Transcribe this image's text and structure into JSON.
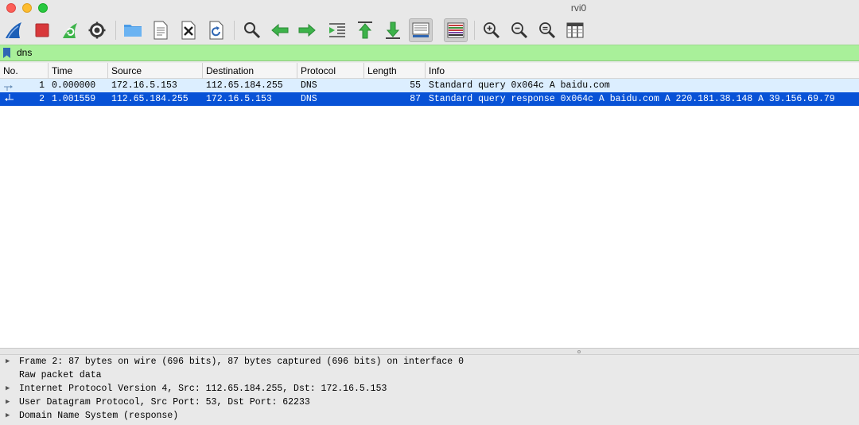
{
  "window": {
    "title": "rvi0"
  },
  "toolbar": {
    "buttons": [
      {
        "name": "start-capture",
        "icon": "shark-fin-icon"
      },
      {
        "name": "stop-capture",
        "icon": "stop-square-icon"
      },
      {
        "name": "restart-capture",
        "icon": "restart-fin-icon"
      },
      {
        "name": "capture-options",
        "icon": "gear-icon"
      },
      {
        "name": "open-file",
        "icon": "folder-icon"
      },
      {
        "name": "save-file",
        "icon": "document-icon"
      },
      {
        "name": "close-file",
        "icon": "close-file-icon"
      },
      {
        "name": "reload-file",
        "icon": "reload-icon"
      },
      {
        "name": "find-packet",
        "icon": "magnifier-icon"
      },
      {
        "name": "go-back",
        "icon": "arrow-left-icon"
      },
      {
        "name": "go-forward",
        "icon": "arrow-right-icon"
      },
      {
        "name": "go-to-packet",
        "icon": "jump-icon"
      },
      {
        "name": "go-first",
        "icon": "arrow-top-icon"
      },
      {
        "name": "go-last",
        "icon": "arrow-bottom-icon"
      },
      {
        "name": "auto-scroll",
        "icon": "autoscroll-icon"
      },
      {
        "name": "colorize",
        "icon": "colorize-icon"
      },
      {
        "name": "zoom-in",
        "icon": "zoom-in-icon"
      },
      {
        "name": "zoom-out",
        "icon": "zoom-out-icon"
      },
      {
        "name": "zoom-reset",
        "icon": "zoom-reset-icon"
      },
      {
        "name": "resize-columns",
        "icon": "resize-columns-icon"
      }
    ],
    "colors": {
      "shark": "#1c5fb7",
      "stop": "#d8393b",
      "green": "#3db34a",
      "folder": "#4a9be6"
    }
  },
  "filter": {
    "value": "dns",
    "background": "#a9f09a"
  },
  "columns": [
    "No.",
    "Time",
    "Source",
    "Destination",
    "Protocol",
    "Length",
    "Info"
  ],
  "packets": [
    {
      "no": "1",
      "time": "0.000000",
      "source": "172.16.5.153",
      "destination": "112.65.184.255",
      "protocol": "DNS",
      "length": "55",
      "info": "Standard query 0x064c A baidu.com"
    },
    {
      "no": "2",
      "time": "1.001559",
      "source": "112.65.184.255",
      "destination": "172.16.5.153",
      "protocol": "DNS",
      "length": "87",
      "info": "Standard query response 0x064c A baidu.com A 220.181.38.148 A 39.156.69.79"
    }
  ],
  "details": [
    {
      "text": "Frame 2: 87 bytes on wire (696 bits), 87 bytes captured (696 bits) on interface 0",
      "expandable": true
    },
    {
      "text": "Raw packet data",
      "expandable": false
    },
    {
      "text": "Internet Protocol Version 4, Src: 112.65.184.255, Dst: 172.16.5.153",
      "expandable": true
    },
    {
      "text": "User Datagram Protocol, Src Port: 53, Dst Port: 62233",
      "expandable": true
    },
    {
      "text": "Domain Name System (response)",
      "expandable": true
    }
  ],
  "selection_color": "#0852d6"
}
